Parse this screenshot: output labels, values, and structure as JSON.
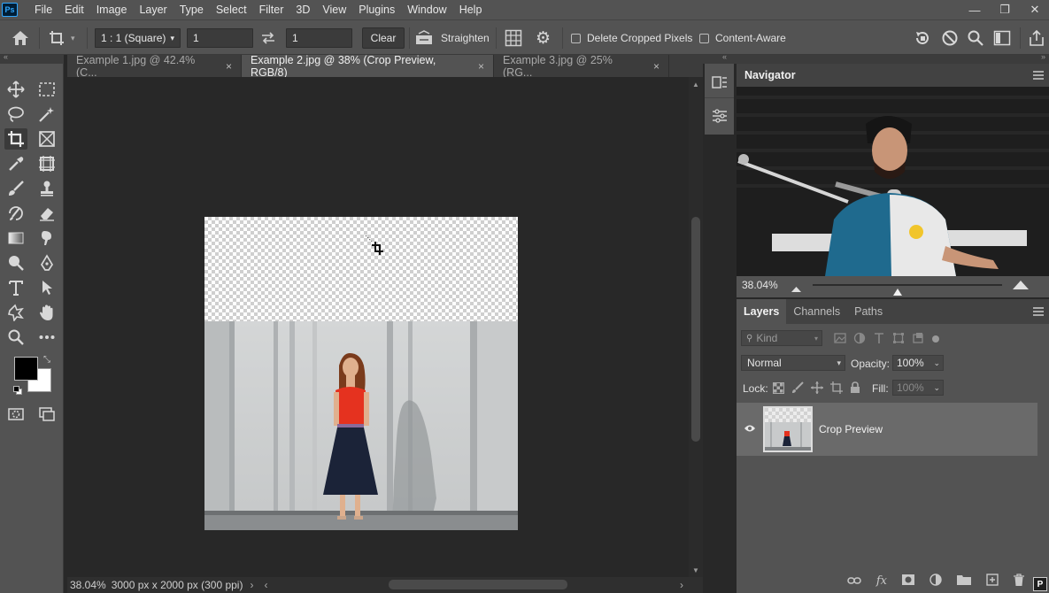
{
  "app": {
    "logo": "Ps"
  },
  "menu": [
    "File",
    "Edit",
    "Image",
    "Layer",
    "Type",
    "Select",
    "Filter",
    "3D",
    "View",
    "Plugins",
    "Window",
    "Help"
  ],
  "window_controls": [
    "minimize-icon",
    "restore-icon",
    "close-icon"
  ],
  "options_bar": {
    "ratio_preset": "1 : 1 (Square)",
    "width_value": "1",
    "height_value": "1",
    "clear_label": "Clear",
    "straighten_label": "Straighten",
    "delete_cropped_label": "Delete Cropped Pixels",
    "delete_cropped_checked": false,
    "content_aware_label": "Content-Aware",
    "content_aware_checked": false
  },
  "tabs": [
    {
      "label": "Example 1.jpg @ 42.4% (C...",
      "active": false
    },
    {
      "label": "Example 2.jpg @ 38% (Crop Preview, RGB/8)",
      "active": true
    },
    {
      "label": "Example 3.jpg @ 25% (RG...",
      "active": false
    }
  ],
  "tab_close_glyph": "×",
  "status": {
    "zoom": "38.04%",
    "doc_info": "3000 px x 2000 px (300 ppi)"
  },
  "navigator": {
    "title": "Navigator",
    "zoom": "38.04%",
    "zoom_slider_fraction": 0.45
  },
  "layers_panel": {
    "tabs": [
      "Layers",
      "Channels",
      "Paths"
    ],
    "filter_label": "Kind",
    "blend_mode": "Normal",
    "opacity_label": "Opacity:",
    "opacity_value": "100%",
    "lock_label": "Lock:",
    "fill_label": "Fill:",
    "fill_value": "100%",
    "layers": [
      {
        "name": "Crop Preview",
        "visible": true
      }
    ]
  },
  "colors": {
    "foreground": "#000000",
    "background": "#ffffff",
    "panel": "#535353",
    "canvas": "#282828"
  }
}
